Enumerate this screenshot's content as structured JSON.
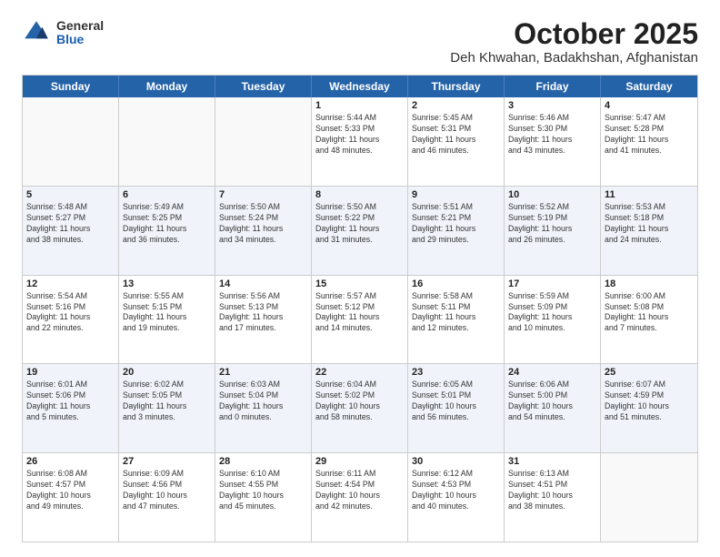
{
  "logo": {
    "general": "General",
    "blue": "Blue"
  },
  "title": "October 2025",
  "location": "Deh Khwahan, Badakhshan, Afghanistan",
  "header_days": [
    "Sunday",
    "Monday",
    "Tuesday",
    "Wednesday",
    "Thursday",
    "Friday",
    "Saturday"
  ],
  "weeks": [
    {
      "alt": false,
      "days": [
        {
          "num": "",
          "info": ""
        },
        {
          "num": "",
          "info": ""
        },
        {
          "num": "",
          "info": ""
        },
        {
          "num": "1",
          "info": "Sunrise: 5:44 AM\nSunset: 5:33 PM\nDaylight: 11 hours\nand 48 minutes."
        },
        {
          "num": "2",
          "info": "Sunrise: 5:45 AM\nSunset: 5:31 PM\nDaylight: 11 hours\nand 46 minutes."
        },
        {
          "num": "3",
          "info": "Sunrise: 5:46 AM\nSunset: 5:30 PM\nDaylight: 11 hours\nand 43 minutes."
        },
        {
          "num": "4",
          "info": "Sunrise: 5:47 AM\nSunset: 5:28 PM\nDaylight: 11 hours\nand 41 minutes."
        }
      ]
    },
    {
      "alt": true,
      "days": [
        {
          "num": "5",
          "info": "Sunrise: 5:48 AM\nSunset: 5:27 PM\nDaylight: 11 hours\nand 38 minutes."
        },
        {
          "num": "6",
          "info": "Sunrise: 5:49 AM\nSunset: 5:25 PM\nDaylight: 11 hours\nand 36 minutes."
        },
        {
          "num": "7",
          "info": "Sunrise: 5:50 AM\nSunset: 5:24 PM\nDaylight: 11 hours\nand 34 minutes."
        },
        {
          "num": "8",
          "info": "Sunrise: 5:50 AM\nSunset: 5:22 PM\nDaylight: 11 hours\nand 31 minutes."
        },
        {
          "num": "9",
          "info": "Sunrise: 5:51 AM\nSunset: 5:21 PM\nDaylight: 11 hours\nand 29 minutes."
        },
        {
          "num": "10",
          "info": "Sunrise: 5:52 AM\nSunset: 5:19 PM\nDaylight: 11 hours\nand 26 minutes."
        },
        {
          "num": "11",
          "info": "Sunrise: 5:53 AM\nSunset: 5:18 PM\nDaylight: 11 hours\nand 24 minutes."
        }
      ]
    },
    {
      "alt": false,
      "days": [
        {
          "num": "12",
          "info": "Sunrise: 5:54 AM\nSunset: 5:16 PM\nDaylight: 11 hours\nand 22 minutes."
        },
        {
          "num": "13",
          "info": "Sunrise: 5:55 AM\nSunset: 5:15 PM\nDaylight: 11 hours\nand 19 minutes."
        },
        {
          "num": "14",
          "info": "Sunrise: 5:56 AM\nSunset: 5:13 PM\nDaylight: 11 hours\nand 17 minutes."
        },
        {
          "num": "15",
          "info": "Sunrise: 5:57 AM\nSunset: 5:12 PM\nDaylight: 11 hours\nand 14 minutes."
        },
        {
          "num": "16",
          "info": "Sunrise: 5:58 AM\nSunset: 5:11 PM\nDaylight: 11 hours\nand 12 minutes."
        },
        {
          "num": "17",
          "info": "Sunrise: 5:59 AM\nSunset: 5:09 PM\nDaylight: 11 hours\nand 10 minutes."
        },
        {
          "num": "18",
          "info": "Sunrise: 6:00 AM\nSunset: 5:08 PM\nDaylight: 11 hours\nand 7 minutes."
        }
      ]
    },
    {
      "alt": true,
      "days": [
        {
          "num": "19",
          "info": "Sunrise: 6:01 AM\nSunset: 5:06 PM\nDaylight: 11 hours\nand 5 minutes."
        },
        {
          "num": "20",
          "info": "Sunrise: 6:02 AM\nSunset: 5:05 PM\nDaylight: 11 hours\nand 3 minutes."
        },
        {
          "num": "21",
          "info": "Sunrise: 6:03 AM\nSunset: 5:04 PM\nDaylight: 11 hours\nand 0 minutes."
        },
        {
          "num": "22",
          "info": "Sunrise: 6:04 AM\nSunset: 5:02 PM\nDaylight: 10 hours\nand 58 minutes."
        },
        {
          "num": "23",
          "info": "Sunrise: 6:05 AM\nSunset: 5:01 PM\nDaylight: 10 hours\nand 56 minutes."
        },
        {
          "num": "24",
          "info": "Sunrise: 6:06 AM\nSunset: 5:00 PM\nDaylight: 10 hours\nand 54 minutes."
        },
        {
          "num": "25",
          "info": "Sunrise: 6:07 AM\nSunset: 4:59 PM\nDaylight: 10 hours\nand 51 minutes."
        }
      ]
    },
    {
      "alt": false,
      "days": [
        {
          "num": "26",
          "info": "Sunrise: 6:08 AM\nSunset: 4:57 PM\nDaylight: 10 hours\nand 49 minutes."
        },
        {
          "num": "27",
          "info": "Sunrise: 6:09 AM\nSunset: 4:56 PM\nDaylight: 10 hours\nand 47 minutes."
        },
        {
          "num": "28",
          "info": "Sunrise: 6:10 AM\nSunset: 4:55 PM\nDaylight: 10 hours\nand 45 minutes."
        },
        {
          "num": "29",
          "info": "Sunrise: 6:11 AM\nSunset: 4:54 PM\nDaylight: 10 hours\nand 42 minutes."
        },
        {
          "num": "30",
          "info": "Sunrise: 6:12 AM\nSunset: 4:53 PM\nDaylight: 10 hours\nand 40 minutes."
        },
        {
          "num": "31",
          "info": "Sunrise: 6:13 AM\nSunset: 4:51 PM\nDaylight: 10 hours\nand 38 minutes."
        },
        {
          "num": "",
          "info": ""
        }
      ]
    }
  ]
}
